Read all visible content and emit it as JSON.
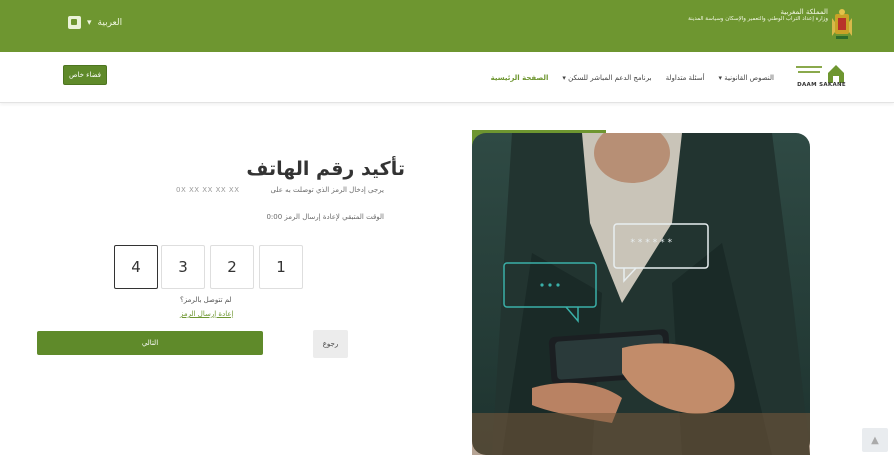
{
  "header": {
    "language": "العربية",
    "ministry_line1": "المملكة المغربية",
    "ministry_line2": "وزارة إعداد التراب الوطني والتعمير والإسكان وسياسة المدينة"
  },
  "nav": {
    "space_button": "فضاء خاص",
    "items": [
      "الصفحة الرئيسية",
      "برنامج الدعم المباشر للسكن",
      "أسئلة متداولة",
      "النصوص القانونية"
    ],
    "brand_text": "DAAM SAKANE"
  },
  "main": {
    "title": "تأكيد رقم الهاتف",
    "instruction": "يرجى إدخال الرمز الذي توصلت به على",
    "masked_phone": "0X XX XX XX XX",
    "timer_text": "الوقت المتبقي لإعادة إرسال الرمز 0:00",
    "otp_digits": [
      "4",
      "3",
      "2",
      "1"
    ],
    "no_code_text": "لم تتوصل بالرمز؟",
    "resend_link": "إعادة إرسال الرمز",
    "next_button": "التالي",
    "back_button": "رجوع",
    "password_bubble": "******"
  },
  "colors": {
    "primary": "#6e9630",
    "button": "#5f8a2a"
  }
}
